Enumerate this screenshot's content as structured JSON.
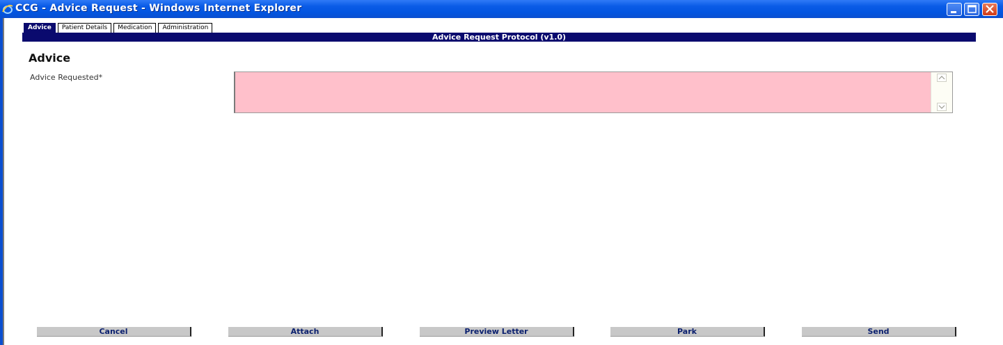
{
  "window": {
    "title": "CCG - Advice Request - Windows Internet Explorer",
    "icon": "internet-explorer-icon",
    "controls": [
      "minimize-icon",
      "maximize-icon",
      "close-icon"
    ]
  },
  "tabs": [
    {
      "label": "Advice",
      "active": true
    },
    {
      "label": "Patient Details",
      "active": false
    },
    {
      "label": "Medication",
      "active": false
    },
    {
      "label": "Administration",
      "active": false
    }
  ],
  "protocol_bar": "Advice Request Protocol (v1.0)",
  "section": {
    "heading": "Advice",
    "field_label": "Advice Requested*",
    "field_value": ""
  },
  "buttons": {
    "cancel": "Cancel",
    "attach": "Attach",
    "preview": "Preview Letter",
    "park": "Park",
    "send": "Send"
  },
  "colors": {
    "titlebar": "#0355e0",
    "protocol_bar": "#0a0a6e",
    "required_field": "#ffc0cb",
    "button_face": "#c8c8c8"
  }
}
